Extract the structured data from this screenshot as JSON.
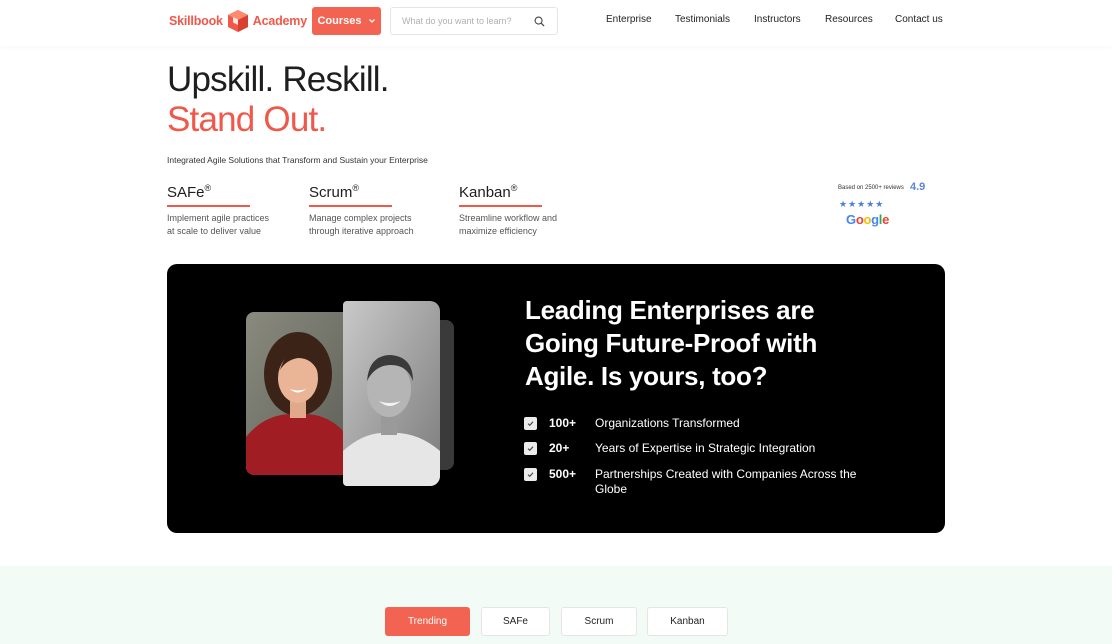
{
  "header": {
    "logo_text_1": "Skillbook",
    "logo_text_2": "Academy",
    "courses_label": "Courses",
    "search_placeholder": "What do you want to learn?",
    "nav": [
      "Enterprise",
      "Testimonials",
      "Instructors",
      "Resources",
      "Contact us"
    ]
  },
  "hero": {
    "headline_1": "Upskill. Reskill.",
    "headline_2": "Stand Out.",
    "tagline": "Integrated Agile Solutions that Transform and Sustain your Enterprise",
    "products": [
      {
        "title": "SAFe",
        "mark": "®",
        "desc": "Implement agile practices at scale to deliver value"
      },
      {
        "title": "Scrum",
        "mark": "®",
        "desc": "Manage complex projects through iterative approach"
      },
      {
        "title": "Kanban",
        "mark": "®",
        "desc": "Streamline workflow and maximize efficiency"
      }
    ],
    "rating": {
      "based_on": "Based on 2500+ reviews",
      "score": "4.9",
      "stars": "★★★★★",
      "provider": "Google"
    }
  },
  "card": {
    "title": "Leading Enterprises are Going Future-Proof with Agile. Is yours, too?",
    "stats": [
      {
        "num": "100+",
        "text": "Organizations Transformed"
      },
      {
        "num": "20+",
        "text": "Years of Expertise in Strategic Integration"
      },
      {
        "num": "500+",
        "text": "Partnerships Created with Companies Across the Globe"
      }
    ]
  },
  "tabs": [
    "Trending",
    "SAFe",
    "Scrum",
    "Kanban"
  ],
  "colors": {
    "accent": "#f26451",
    "brand_red": "#f0584a",
    "card_bg": "#000000",
    "rating_blue": "#4e7ed8",
    "bottom_bg": "#f3fbf6"
  },
  "icons": [
    "logo-cube-icon",
    "chevron-down-icon",
    "search-icon",
    "check-icon",
    "star-icon"
  ]
}
